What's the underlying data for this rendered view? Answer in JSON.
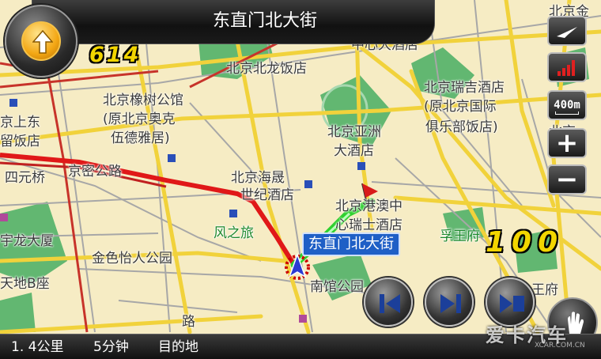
{
  "header": {
    "street_name": "东直门北大街",
    "turn_distance": "614",
    "direction_icon": "arrow-up-icon"
  },
  "map": {
    "pois": [
      {
        "text": "北京北龙饭店",
        "style": ""
      },
      {
        "text": "中心大酒店",
        "style": ""
      },
      {
        "text": "北京橡树公馆",
        "style": ""
      },
      {
        "text": "(原北京奥克",
        "style": ""
      },
      {
        "text": "伍德雅居)",
        "style": ""
      },
      {
        "text": "北京亚洲",
        "style": ""
      },
      {
        "text": "大酒店",
        "style": ""
      },
      {
        "text": "北京瑞吉酒店",
        "style": ""
      },
      {
        "text": "(原北京国际",
        "style": ""
      },
      {
        "text": "俱乐部饭店)",
        "style": ""
      },
      {
        "text": "京上东",
        "style": ""
      },
      {
        "text": "留饭店",
        "style": ""
      },
      {
        "text": "四元桥",
        "style": ""
      },
      {
        "text": "京密公路",
        "style": ""
      },
      {
        "text": "北京海晟",
        "style": ""
      },
      {
        "text": "世纪酒店",
        "style": ""
      },
      {
        "text": "北京港澳中",
        "style": ""
      },
      {
        "text": "心瑞士酒店",
        "style": ""
      },
      {
        "text": "风之旅",
        "style": "green"
      },
      {
        "text": "孚王府",
        "style": "green"
      },
      {
        "text": "宇龙大厦",
        "style": ""
      },
      {
        "text": "金色怡人公园",
        "style": ""
      },
      {
        "text": "天地B座",
        "style": ""
      },
      {
        "text": "南馆公园",
        "style": ""
      },
      {
        "text": "北京金",
        "style": ""
      },
      {
        "text": "北京",
        "style": ""
      },
      {
        "text": "王府",
        "style": ""
      },
      {
        "text": "路",
        "style": ""
      }
    ],
    "callout": "东直门北大街",
    "speed_limit": "100"
  },
  "controls": {
    "compass_icon": "compass-arrow-icon",
    "signal_icon": "gps-signal-icon",
    "scale_label": "400m",
    "zoom_in_label": "+",
    "zoom_out_label": "−"
  },
  "media": {
    "previous_icon": "previous-icon",
    "next_icon": "next-icon",
    "stop_icon": "stop-icon",
    "menu_icon": "hand-icon"
  },
  "status": {
    "remaining_distance": "1. 4公里",
    "remaining_time": "5分钟",
    "destination_label": "目的地"
  },
  "watermark": {
    "main": "爱卡汽车",
    "sub": "XCAR.COM.CN"
  },
  "colors": {
    "map_bg": "#f6ecc4",
    "route": "#e21b1b",
    "traveled": "#2fd02f",
    "park": "#5fb86d"
  }
}
